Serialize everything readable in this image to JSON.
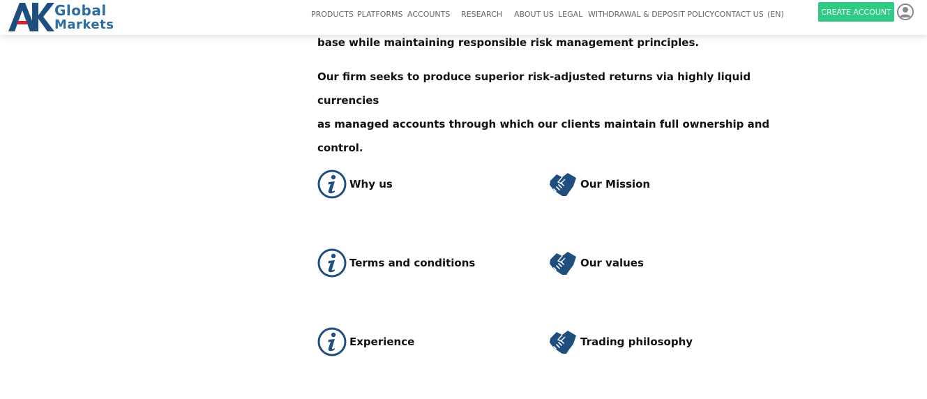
{
  "brand": {
    "mark": "AK",
    "line1": "Global",
    "line2": "Markets"
  },
  "nav": {
    "items": [
      {
        "label": "PRODUCTS"
      },
      {
        "label": "PLATFORMS"
      },
      {
        "label": "ACCOUNTS"
      },
      {
        "label": "RESEARCH"
      },
      {
        "label": "ABOUT US"
      },
      {
        "label": "LEGAL"
      },
      {
        "label": "WITHDRAWAL & DEPOSIT POLICY"
      },
      {
        "label": "CONTACT US"
      },
      {
        "label": "(EN)"
      }
    ],
    "cta_label": "CREATE ACCOUNT"
  },
  "content": {
    "paragraph1": "base while maintaining responsible risk management principles.",
    "paragraph2_lines": [
      "Our firm seeks to produce superior risk-adjusted returns via highly liquid currencies",
      "as managed accounts through which our clients maintain full ownership and",
      "control."
    ]
  },
  "features": {
    "left": [
      {
        "label": "Why us",
        "icon": "info-icon"
      },
      {
        "label": "Terms and conditions",
        "icon": "info-icon"
      },
      {
        "label": "Experience",
        "icon": "info-icon"
      }
    ],
    "right": [
      {
        "label": "Our Mission",
        "icon": "handshake-icon"
      },
      {
        "label": "Our values",
        "icon": "handshake-icon"
      },
      {
        "label": "Trading philosophy",
        "icon": "handshake-icon"
      }
    ]
  },
  "colors": {
    "brand_blue": "#1f4f7f",
    "logo_blue": "#2e6da4",
    "logo_red": "#d9232e",
    "cta_green": "#2fcb84"
  }
}
